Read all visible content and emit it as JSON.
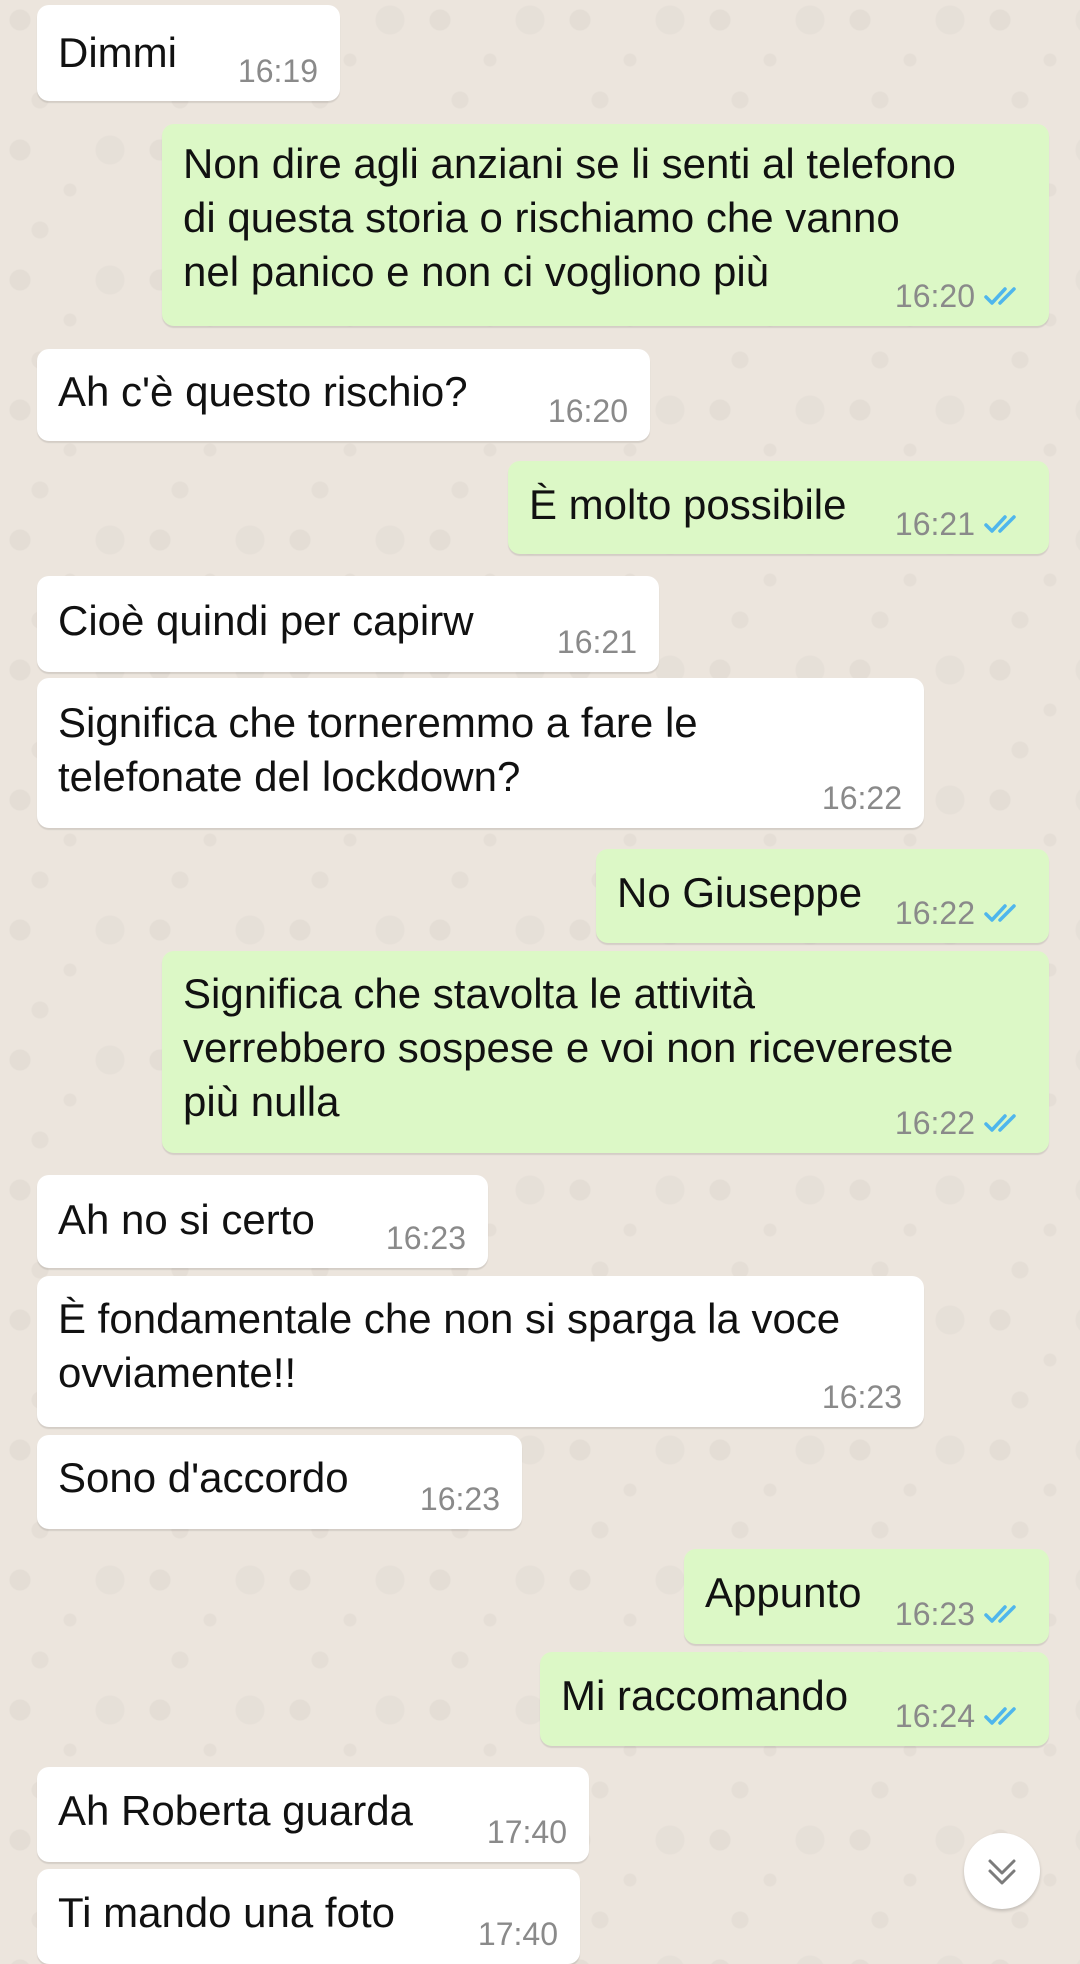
{
  "chat": {
    "messages": [
      {
        "direction": "in",
        "text": "Dimmi",
        "time": "16:19"
      },
      {
        "direction": "out",
        "text": "Non dire agli anziani se li senti al telefono\ndi questa storia o rischiamo che vanno\nnel panico e non ci vogliono più",
        "time": "16:20",
        "status": "read"
      },
      {
        "direction": "in",
        "text": "Ah c'è questo rischio?",
        "time": "16:20"
      },
      {
        "direction": "out",
        "text": "È molto possibile",
        "time": "16:21",
        "status": "read"
      },
      {
        "direction": "in",
        "text": "Cioè quindi per capirw",
        "time": "16:21"
      },
      {
        "direction": "in",
        "text": "Significa che torneremmo a fare le\ntelefonate del lockdown?",
        "time": "16:22"
      },
      {
        "direction": "out",
        "text": "No Giuseppe",
        "time": "16:22",
        "status": "read"
      },
      {
        "direction": "out",
        "text": "Significa che stavolta le attività\nverrebbero sospese e voi non ricevereste\npiù nulla",
        "time": "16:22",
        "status": "read"
      },
      {
        "direction": "in",
        "text": "Ah no si certo",
        "time": "16:23"
      },
      {
        "direction": "in",
        "text": "È fondamentale che non si sparga la voce\novviamente!!",
        "time": "16:23"
      },
      {
        "direction": "in",
        "text": "Sono d'accordo",
        "time": "16:23"
      },
      {
        "direction": "out",
        "text": "Appunto",
        "time": "16:23",
        "status": "read"
      },
      {
        "direction": "out",
        "text": "Mi raccomando",
        "time": "16:24",
        "status": "read"
      },
      {
        "direction": "in",
        "text": "Ah Roberta guarda",
        "time": "17:40"
      },
      {
        "direction": "in",
        "text": "Ti mando una foto",
        "time": "17:40"
      }
    ]
  },
  "colors": {
    "background": "#ece5dd",
    "incoming_bubble": "#ffffff",
    "outgoing_bubble": "#dcf8c6",
    "read_ticks": "#4fb6ec",
    "timestamp": "#8a8a8a"
  },
  "icons": {
    "read_receipt": "double-check-icon",
    "scroll_down": "chevron-down-double-icon"
  }
}
